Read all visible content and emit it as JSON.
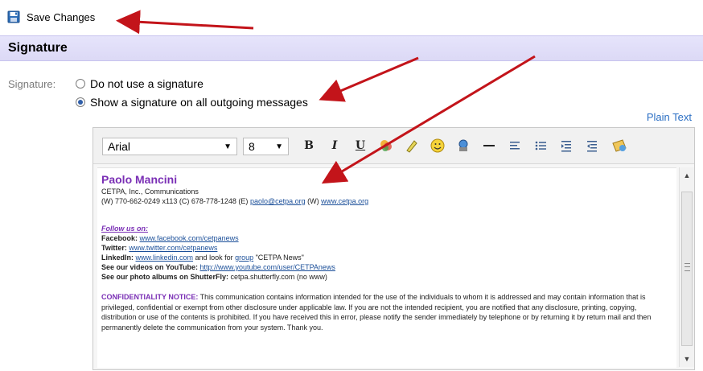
{
  "toolbar": {
    "save_label": "Save Changes"
  },
  "section": {
    "title": "Signature"
  },
  "signature": {
    "label": "Signature:",
    "option_none": "Do not use a signature",
    "option_show": "Show a signature on all outgoing messages",
    "selected": "show"
  },
  "plain_text_link": "Plain Text",
  "editor": {
    "font": "Arial",
    "size": "8",
    "icons": [
      "bold-icon",
      "italic-icon",
      "underline-icon",
      "text-color-icon",
      "highlight-icon",
      "emoticon-icon",
      "link-icon",
      "horizontal-rule-icon",
      "align-icon",
      "bullet-list-icon",
      "indent-icon",
      "outdent-icon",
      "image-icon"
    ],
    "content": {
      "name": "Paolo Mancini",
      "company": "CETPA, Inc., Communications",
      "contact_prefix": "(W) 770-662-0249 x113 (C) 678-778-1248 (E) ",
      "email": "paolo@cetpa.org",
      "contact_mid": " (W) ",
      "website": "www.cetpa.org",
      "follow": "Follow us on:",
      "facebook_label": "Facebook:",
      "facebook_url": "www.facebook.com/cetpanews",
      "twitter_label": "Twitter:",
      "twitter_url": "www.twitter.com/cetpanews",
      "linkedin_label": "LinkedIn:",
      "linkedin_url": "www.linkedin.com",
      "linkedin_mid": " and look for ",
      "linkedin_group": "group",
      "linkedin_end": " \"CETPA News\"",
      "youtube_label": "See our videos on YouTube:",
      "youtube_url": "http://www.youtube.com/user/CETPAnews",
      "shutterfly_label": "See our photo albums on ShutterFly:",
      "shutterfly_text": " cetpa.shutterfly.com (no www)",
      "confidentiality_title": "CONFIDENTIALITY NOTICE:",
      "confidentiality_text": " This communication contains information intended for the use of the individuals to whom it is addressed and may contain information that is privileged, confidential or exempt from other disclosure under applicable law. If you are not the intended recipient, you are notified that any disclosure, printing, copying, distribution or use of the contents is prohibited. If you have received this in error, please notify the sender immediately by telephone or by returning it by return mail and then permanently delete the communication from your system. Thank you."
    }
  },
  "colors": {
    "header_bg": "#e4e2fa",
    "name": "#7a2fb5",
    "link": "#1b4f99",
    "arrow": "#c3141a"
  }
}
